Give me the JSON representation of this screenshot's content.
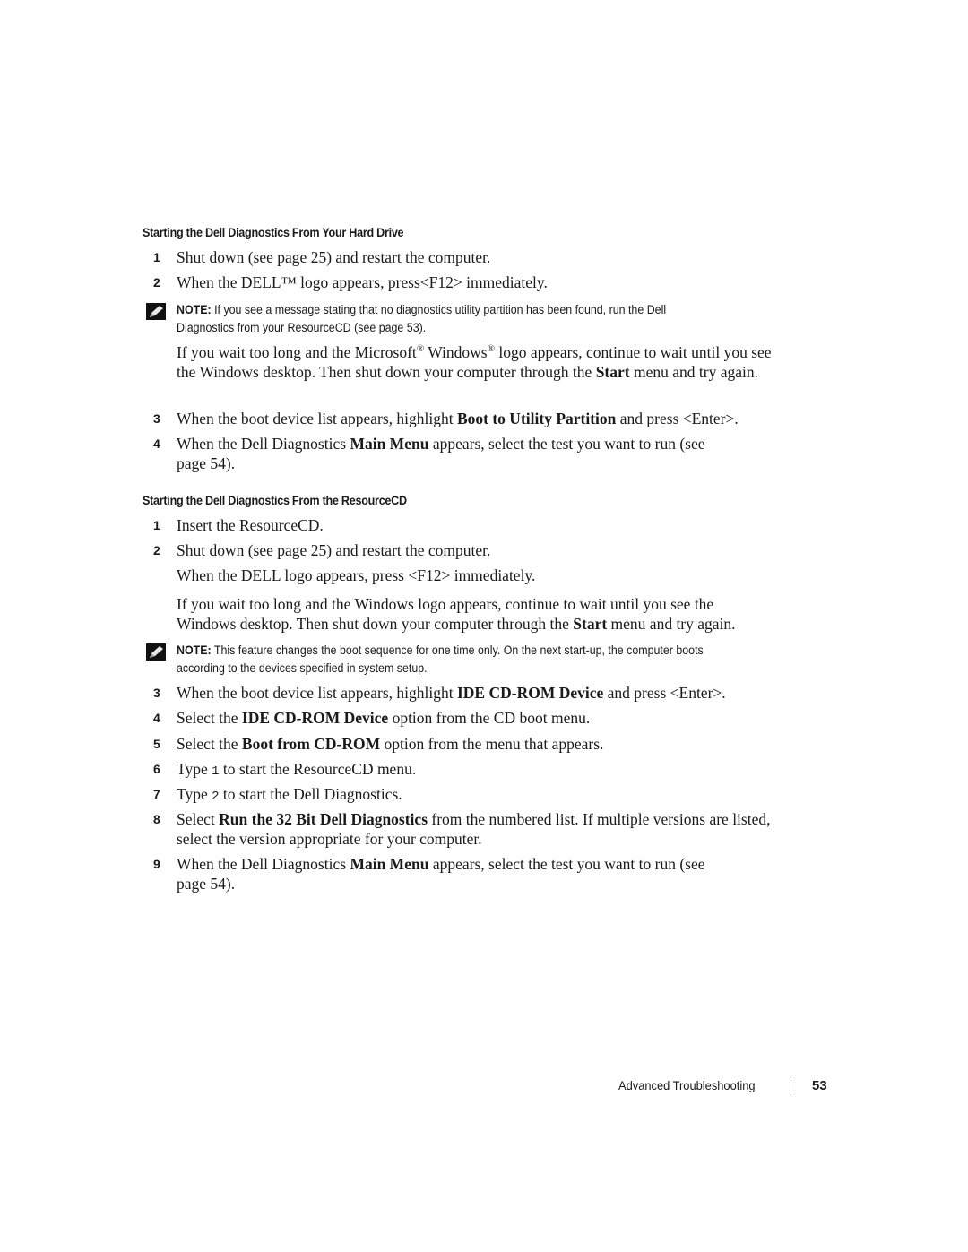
{
  "section1": {
    "heading": "Starting the Dell Diagnostics From Your Hard Drive",
    "steps": [
      {
        "num": "1",
        "text": "Shut down (see page 25) and restart the computer."
      },
      {
        "num": "2",
        "text": "When the DELL™ logo appears, press<F12> immediately."
      }
    ],
    "note": {
      "label": "NOTE:",
      "text": " If you see a message stating that no diagnostics utility partition has been found, run the Dell Diagnostics from your ResourceCD (see page 53)."
    },
    "wait_para": {
      "a": "If you wait too long and the Microsoft",
      "reg1": "®",
      "b": " Windows",
      "reg2": "®",
      "c": " logo appears, continue to wait until you see the Windows desktop. Then shut down your computer through the ",
      "bold": "Start",
      "d": " menu and try again."
    },
    "step3": {
      "num": "3",
      "a": "When the boot device list appears, highlight ",
      "bold": "Boot to Utility Partition",
      "b": " and press <Enter>."
    },
    "step4": {
      "num": "4",
      "a": "When the Dell Diagnostics ",
      "bold": "Main Menu",
      "b": " appears, select the test you want to run (see page 54)."
    }
  },
  "section2": {
    "heading": "Starting the Dell Diagnostics From the ResourceCD",
    "step1": {
      "num": "1",
      "text": "Insert the ResourceCD."
    },
    "step2": {
      "num": "2",
      "text": "Shut down (see page 25) and restart the computer."
    },
    "f12_para": "When the DELL logo appears, press <F12> immediately.",
    "wait_para": {
      "a": "If you wait too long and the Windows logo appears, continue to wait until you see the Windows desktop. Then shut down your computer through the ",
      "bold": "Start",
      "b": " menu and try again."
    },
    "note": {
      "label": "NOTE:",
      "text": " This feature changes the boot sequence for one time only. On the next start-up, the computer boots according to the devices specified in system setup."
    },
    "step3": {
      "num": "3",
      "a": "When the boot device list appears, highlight ",
      "bold": "IDE CD-ROM Device",
      "b": " and press <Enter>."
    },
    "step4": {
      "num": "4",
      "a": "Select the ",
      "bold": "IDE CD-ROM Device",
      "b": " option from the CD boot menu."
    },
    "step5": {
      "num": "5",
      "a": "Select the ",
      "bold": "Boot from CD-ROM",
      "b": " option from the menu that appears."
    },
    "step6": {
      "num": "6",
      "a": "Type ",
      "code": "1",
      "b": " to start the ResourceCD menu."
    },
    "step7": {
      "num": "7",
      "a": "Type ",
      "code": "2",
      "b": " to start the Dell Diagnostics."
    },
    "step8": {
      "num": "8",
      "a": "Select ",
      "bold": "Run the 32 Bit Dell Diagnostics",
      "b": " from the numbered list. If multiple versions are listed, select the version appropriate for your computer."
    },
    "step9": {
      "num": "9",
      "a": "When the Dell Diagnostics ",
      "bold": "Main Menu",
      "b": " appears, select the test you want to run (see page 54)."
    }
  },
  "footer": {
    "section_title": "Advanced Troubleshooting",
    "page_number": "53"
  },
  "icons": {
    "note": "pencil-note-icon"
  }
}
